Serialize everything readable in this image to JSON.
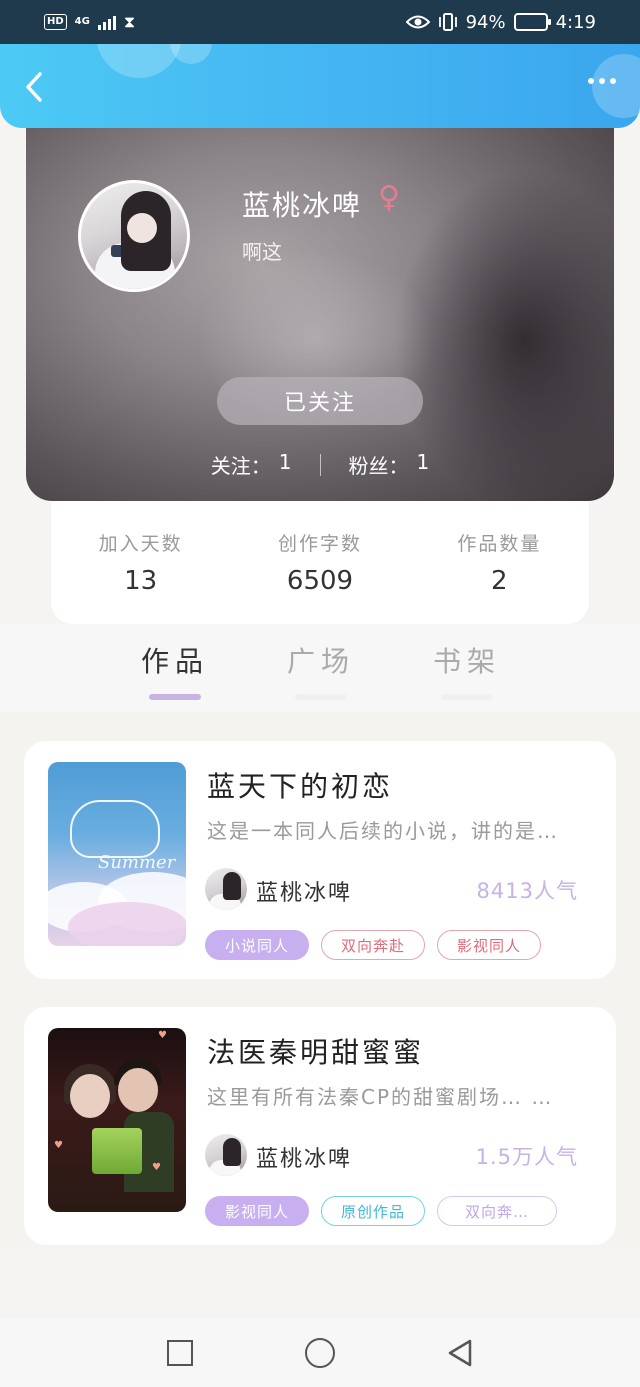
{
  "status_bar": {
    "hd_label": "HD",
    "network_label": "4G",
    "battery_percent": "94%",
    "battery_level": 0.94,
    "time": "4:19"
  },
  "header": {
    "back_icon": "chevron-left-icon",
    "more_icon": "more-horizontal-icon"
  },
  "profile": {
    "name": "蓝桃冰啤",
    "gender_symbol": "♀",
    "bio": "啊这",
    "follow_button": "已关注",
    "following_label": "关注：",
    "following_value": "1",
    "fans_label": "粉丝：",
    "fans_value": "1"
  },
  "stats": [
    {
      "label": "加入天数",
      "value": "13"
    },
    {
      "label": "创作字数",
      "value": "6509"
    },
    {
      "label": "作品数量",
      "value": "2"
    }
  ],
  "tabs": [
    {
      "label": "作品",
      "active": true
    },
    {
      "label": "广场",
      "active": false
    },
    {
      "label": "书架",
      "active": false
    }
  ],
  "works": [
    {
      "title": "蓝天下的初恋",
      "description": "这是一本同人后续的小说，讲的是…",
      "author": "蓝桃冰啤",
      "popularity": "8413人气",
      "cover_text": "Summer",
      "tags": [
        {
          "label": "小说同人",
          "style": "purple-fill"
        },
        {
          "label": "双向奔赴",
          "style": "red-outline"
        },
        {
          "label": "影视同人",
          "style": "red-outline"
        }
      ]
    },
    {
      "title": "法医秦明甜蜜蜜",
      "description": "这里有所有法秦CP的甜蜜剧场… …",
      "author": "蓝桃冰啤",
      "popularity": "1.5万人气",
      "tags": [
        {
          "label": "影视同人",
          "style": "purple-fill"
        },
        {
          "label": "原创作品",
          "style": "cyan-outline"
        },
        {
          "label": "双向奔…",
          "style": "lilac-outline"
        }
      ]
    }
  ],
  "nav": {
    "recent_icon": "square-icon",
    "home_icon": "circle-icon",
    "back_icon": "triangle-back-icon"
  }
}
